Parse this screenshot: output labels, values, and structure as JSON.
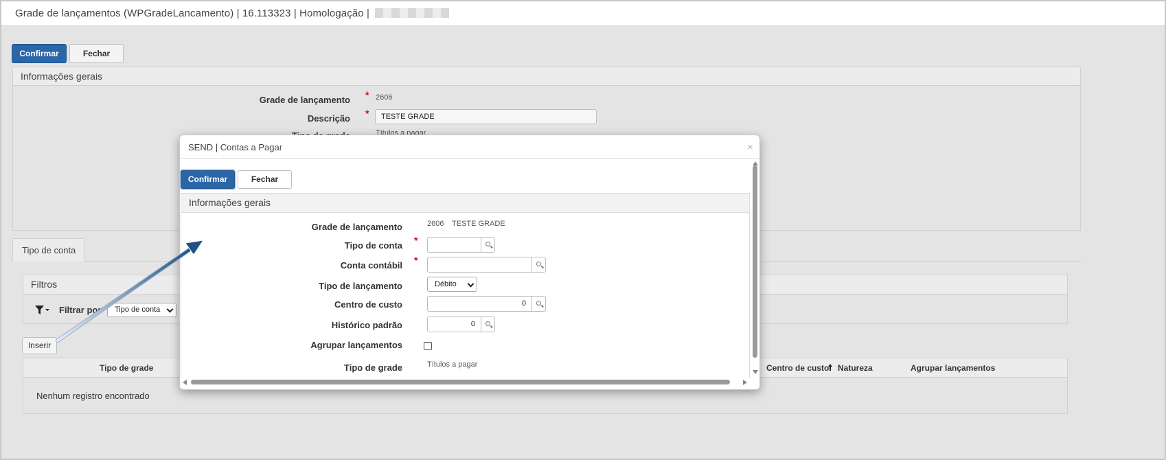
{
  "titlebar": {
    "title": "Grade de lançamentos (WPGradeLancamento) | 16.113323 | Homologação | "
  },
  "toolbar": {
    "confirm_label": "Confirmar",
    "close_label": "Fechar"
  },
  "general": {
    "header": "Informações gerais",
    "grade_label": "Grade de lançamento",
    "grade_value": "2606",
    "descricao_label": "Descrição",
    "descricao_value": "TESTE GRADE",
    "tipo_label_partial": "Tipo de grade",
    "tipo_value_partial": "Títulos a pagar"
  },
  "tabs": [
    {
      "label": "Tipo de conta"
    }
  ],
  "filters": {
    "header": "Filtros",
    "filter_by_label": "Filtrar por",
    "filter_select_value": "Tipo de conta"
  },
  "actions": {
    "insert_label": "Inserir"
  },
  "table": {
    "columns": {
      "tipo_grade": "Tipo de grade",
      "centro_custo": "Centro de custo",
      "natureza": "Natureza",
      "agrupar": "Agrupar lançamentos"
    },
    "empty_message": "Nenhum registro encontrado"
  },
  "modal": {
    "title": "SEND | Contas a Pagar",
    "close_symbol": "×",
    "confirm_label": "Confirmar",
    "close_label": "Fechar",
    "section_header": "Informações gerais",
    "fields": {
      "grade_label": "Grade de lançamento",
      "grade_code": "2606",
      "grade_desc": "TESTE GRADE",
      "tipo_conta_label": "Tipo de conta",
      "tipo_conta_value": "",
      "conta_contabil_label": "Conta contábil",
      "conta_contabil_value": "",
      "tipo_lancamento_label": "Tipo de lançamento",
      "tipo_lancamento_value": "Débito",
      "centro_custo_label": "Centro de custo",
      "centro_custo_value": "0",
      "historico_label": "Histórico padrão",
      "historico_value": "0",
      "agrupar_label": "Agrupar lançamentos",
      "agrupar_checked": false,
      "tipo_grade_label": "Tipo de grade",
      "tipo_grade_value": "Títulos a pagar"
    }
  },
  "required_mark": "*",
  "colors": {
    "primary": "#2a66a8",
    "required": "#d01010",
    "annotation_arrow": "#1e4f86"
  },
  "icons": [
    "filter-icon",
    "search-icon",
    "sort-up-icon",
    "close-icon",
    "arrow-annotation-icon"
  ]
}
